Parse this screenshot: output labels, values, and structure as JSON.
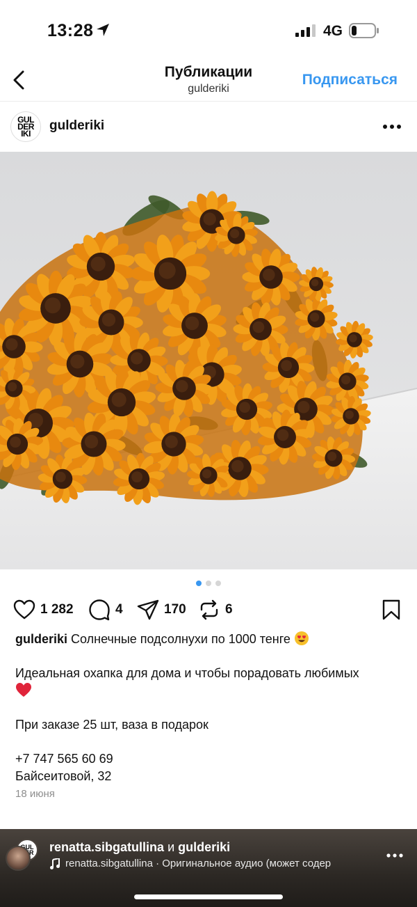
{
  "status_bar": {
    "time": "13:28",
    "network": "4G",
    "icons": [
      "location-arrow-icon",
      "signal-icon",
      "battery-icon"
    ]
  },
  "nav": {
    "title": "Публикации",
    "subtitle": "gulderiki",
    "subscribe_label": "Подписаться",
    "accent_color": "#3897f0",
    "icons": [
      "back-chevron-icon"
    ]
  },
  "post": {
    "username": "gulderiki",
    "avatar_text": [
      "GUL",
      "DER",
      "IKI"
    ],
    "image_icon": "sunflowers-photo",
    "carousel": {
      "count": 3,
      "active": 1
    },
    "actions": {
      "likes": "1 282",
      "comments": "4",
      "shares": "170",
      "reposts": "6"
    },
    "caption": {
      "user": "gulderiki",
      "line1": "Солнечные подсолнухи по 1000 тенге",
      "line2": "Идеальная охапка для дома и чтобы порадовать любимых",
      "line3": "При заказе 25 шт, ваза в подарок",
      "phone": "+7 747 565 60 69",
      "address": "Байсеитовой, 32"
    },
    "date": "18 июня"
  },
  "bottom_bar": {
    "user1": "renatta.sibgatullina",
    "connector": "и",
    "user2": "gulderiki",
    "audio": "renatta.sibgatullina · Оригинальное аудио  (может содер"
  }
}
